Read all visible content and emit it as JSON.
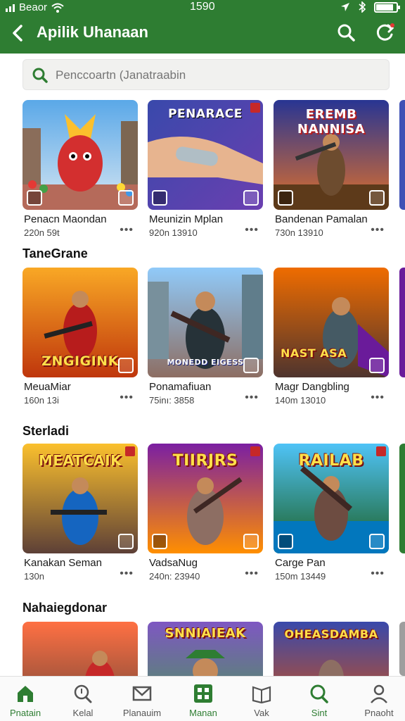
{
  "status": {
    "carrier": "Beaor",
    "time": "1590",
    "battery_level": 0.85
  },
  "appbar": {
    "title": "Apilik Uhanaan",
    "back_icon": "back-arrow-icon",
    "search_icon": "search-icon",
    "sync_icon": "sync-icon"
  },
  "search": {
    "placeholder": "Penccoartn (Janatraabin"
  },
  "sections": [
    {
      "title": "",
      "items": [
        {
          "name": "Penacn Maondan",
          "meta": "220n 59t",
          "art": "Dragon Mascot",
          "overlay": ""
        },
        {
          "name": "Meunizin Mplan",
          "meta": "920n 13910",
          "art": "Hand",
          "overlay": "PENARACE"
        },
        {
          "name": "Bandenan Pamalan",
          "meta": "730n 13910",
          "art": "Soldier",
          "overlay": "EREMB NANNISA"
        }
      ]
    },
    {
      "title": "TaneGrane",
      "items": [
        {
          "name": "MeuaMiar",
          "meta": "160n 13i",
          "art": "Red Soldier",
          "overlay": "ZNGIGINK"
        },
        {
          "name": "Ponamafiuan",
          "meta": "75inı: 3858",
          "art": "Gunner",
          "overlay": "MONEDD EIGESS"
        },
        {
          "name": "Magr Dangbling",
          "meta": "140m 13010",
          "art": "Warrior",
          "overlay": "NAST ASA"
        }
      ]
    },
    {
      "title": "Sterladi",
      "items": [
        {
          "name": "Kanakan Seman",
          "meta": "130n",
          "art": "Blue Soldier",
          "overlay": "MEATCAIK"
        },
        {
          "name": "VadsaNug",
          "meta": "240n: 23940",
          "art": "Gold Soldier",
          "overlay": "TIIRJRS"
        },
        {
          "name": "Carge Pan",
          "meta": "150m 13449",
          "art": "Rifleman",
          "overlay": "RAILAB"
        }
      ]
    },
    {
      "title": "Nahaiegdonar",
      "items": [
        {
          "name": "",
          "meta": "",
          "art": "Desert",
          "overlay": ""
        },
        {
          "name": "",
          "meta": "",
          "art": "Elf",
          "overlay": "SNNIAIEAK"
        },
        {
          "name": "",
          "meta": "",
          "art": "Bearded Man",
          "overlay": "OHEASDAMBA"
        }
      ]
    }
  ],
  "nav": [
    {
      "label": "Pnatain",
      "icon": "home-icon",
      "active": true
    },
    {
      "label": "Kelal",
      "icon": "search-icon",
      "active": false
    },
    {
      "label": "Planauim",
      "icon": "mail-icon",
      "active": false
    },
    {
      "label": "Manan",
      "icon": "grid-icon",
      "active": true
    },
    {
      "label": "Vak",
      "icon": "book-icon",
      "active": false
    },
    {
      "label": "Sint",
      "icon": "search-icon",
      "active": true
    },
    {
      "label": "Pnaoht",
      "icon": "profile-icon",
      "active": false
    }
  ],
  "colors": {
    "primary": "#2e7d32",
    "surface": "#ffffff",
    "nav_bg": "#fafafa"
  }
}
